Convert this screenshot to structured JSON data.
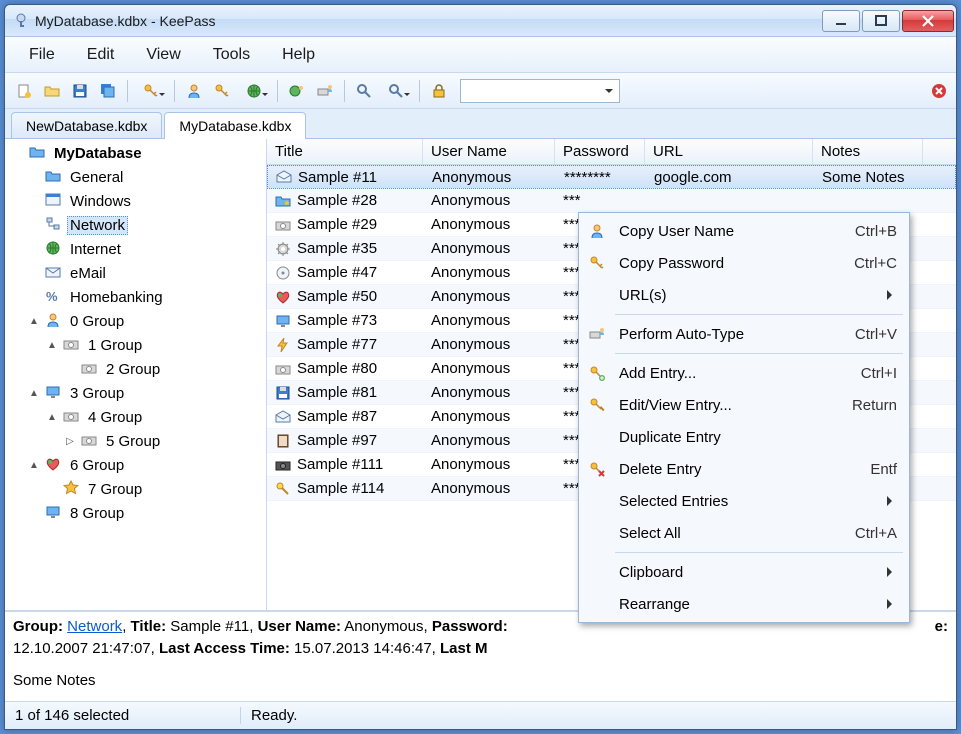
{
  "window": {
    "title": "MyDatabase.kdbx - KeePass"
  },
  "menu": {
    "items": [
      "File",
      "Edit",
      "View",
      "Tools",
      "Help"
    ]
  },
  "toolbar": {
    "buttons": [
      "new-file",
      "open-file",
      "save",
      "save-all",
      "|",
      "add-key",
      "|",
      "add-user",
      "key",
      "world",
      "|",
      "world-user",
      "autotype",
      "|",
      "find",
      "find-dd",
      "|",
      "lock"
    ],
    "close_icon": "close-db"
  },
  "tabs": {
    "items": [
      {
        "label": "NewDatabase.kdbx",
        "active": false
      },
      {
        "label": "MyDatabase.kdbx",
        "active": true
      }
    ]
  },
  "tree": {
    "root": "MyDatabase",
    "items": [
      {
        "label": "General",
        "icon": "folder-blue",
        "indent": 1
      },
      {
        "label": "Windows",
        "icon": "windows",
        "indent": 1
      },
      {
        "label": "Network",
        "icon": "network",
        "indent": 1,
        "selected": true
      },
      {
        "label": "Internet",
        "icon": "globe",
        "indent": 1
      },
      {
        "label": "eMail",
        "icon": "mail",
        "indent": 1
      },
      {
        "label": "Homebanking",
        "icon": "percent",
        "indent": 1
      },
      {
        "label": "0 Group",
        "icon": "user",
        "indent": 1,
        "expander": "▲"
      },
      {
        "label": "1 Group",
        "icon": "camera",
        "indent": 2,
        "expander": "▲"
      },
      {
        "label": "2 Group",
        "icon": "camera",
        "indent": 3
      },
      {
        "label": "3 Group",
        "icon": "monitor",
        "indent": 1,
        "expander": "▲"
      },
      {
        "label": "4 Group",
        "icon": "camera",
        "indent": 2,
        "expander": "▲"
      },
      {
        "label": "5 Group",
        "icon": "camera",
        "indent": 3,
        "expander": "▷"
      },
      {
        "label": "6 Group",
        "icon": "heart",
        "indent": 1,
        "expander": "▲"
      },
      {
        "label": "7 Group",
        "icon": "star",
        "indent": 2
      },
      {
        "label": "8 Group",
        "icon": "monitor",
        "indent": 1
      }
    ]
  },
  "list": {
    "columns": [
      "Title",
      "User Name",
      "Password",
      "URL",
      "Notes"
    ],
    "rows": [
      {
        "icon": "mail-open",
        "title": "Sample #11",
        "user": "Anonymous",
        "pass": "********",
        "url": "google.com",
        "notes": "Some Notes",
        "selected": true
      },
      {
        "icon": "folder-fav",
        "title": "Sample #28",
        "user": "Anonymous",
        "pass": "***"
      },
      {
        "icon": "camera",
        "title": "Sample #29",
        "user": "Anonymous",
        "pass": "***"
      },
      {
        "icon": "gear",
        "title": "Sample #35",
        "user": "Anonymous",
        "pass": "***"
      },
      {
        "icon": "disc",
        "title": "Sample #47",
        "user": "Anonymous",
        "pass": "***"
      },
      {
        "icon": "heart",
        "title": "Sample #50",
        "user": "Anonymous",
        "pass": "***"
      },
      {
        "icon": "monitor",
        "title": "Sample #73",
        "user": "Anonymous",
        "pass": "***"
      },
      {
        "icon": "bolt",
        "title": "Sample #77",
        "user": "Anonymous",
        "pass": "***"
      },
      {
        "icon": "camera",
        "title": "Sample #80",
        "user": "Anonymous",
        "pass": "***"
      },
      {
        "icon": "floppy",
        "title": "Sample #81",
        "user": "Anonymous",
        "pass": "***"
      },
      {
        "icon": "mail-open",
        "title": "Sample #87",
        "user": "Anonymous",
        "pass": "***"
      },
      {
        "icon": "book",
        "title": "Sample #97",
        "user": "Anonymous",
        "pass": "***"
      },
      {
        "icon": "camera-dark",
        "title": "Sample #111",
        "user": "Anonymous",
        "pass": "***"
      },
      {
        "icon": "key-yellow",
        "title": "Sample #114",
        "user": "Anonymous",
        "pass": "***"
      }
    ]
  },
  "details": {
    "group_label": "Group:",
    "group_link": "Network",
    "title_label": "Title:",
    "title_value": "Sample #11",
    "user_label": "User Name:",
    "user_value": "Anonymous",
    "pass_label": "Password:",
    "line2_prefix": "12.10.2007 21:47:07,",
    "lat_label": "Last Access Time:",
    "lat_value": "15.07.2013 14:46:47,",
    "lm_label": "Last M",
    "time_tail_label": "e:",
    "notes": "Some Notes"
  },
  "status": {
    "selection": "1 of 146 selected",
    "message": "Ready."
  },
  "context_menu": {
    "items": [
      {
        "icon": "user",
        "label": "Copy User Name",
        "shortcut": "Ctrl+B"
      },
      {
        "icon": "key",
        "label": "Copy Password",
        "shortcut": "Ctrl+C"
      },
      {
        "label": "URL(s)",
        "submenu": true
      },
      {
        "sep": true
      },
      {
        "icon": "autotype",
        "label": "Perform Auto-Type",
        "shortcut": "Ctrl+V"
      },
      {
        "sep": true
      },
      {
        "icon": "key-add",
        "label": "Add Entry...",
        "shortcut": "Ctrl+I"
      },
      {
        "icon": "key-edit",
        "label": "Edit/View Entry...",
        "shortcut": "Return"
      },
      {
        "label": "Duplicate Entry"
      },
      {
        "icon": "key-del",
        "label": "Delete Entry",
        "shortcut": "Entf"
      },
      {
        "label": "Selected Entries",
        "submenu": true
      },
      {
        "label": "Select All",
        "shortcut": "Ctrl+A"
      },
      {
        "sep": true
      },
      {
        "label": "Clipboard",
        "submenu": true
      },
      {
        "label": "Rearrange",
        "submenu": true
      }
    ]
  }
}
